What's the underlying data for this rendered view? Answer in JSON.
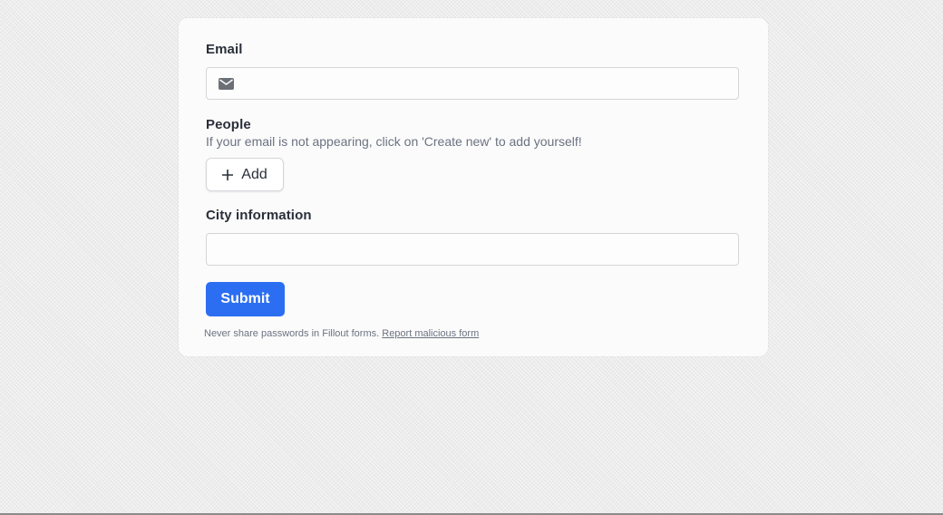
{
  "form": {
    "email": {
      "label": "Email",
      "value": "",
      "icon": "mail-icon"
    },
    "people": {
      "label": "People",
      "helper": "If your email is not appearing, click on 'Create new' to add yourself!",
      "add_label": "Add",
      "add_icon": "plus-icon"
    },
    "city": {
      "label": "City information",
      "value": ""
    },
    "submit_label": "Submit"
  },
  "footer": {
    "notice": "Never share passwords in Fillout forms.",
    "report_link": "Report malicious form"
  },
  "colors": {
    "accent": "#2b6ef2",
    "text": "#2a2f3a",
    "muted": "#6b7280",
    "border": "#d4d6da"
  }
}
